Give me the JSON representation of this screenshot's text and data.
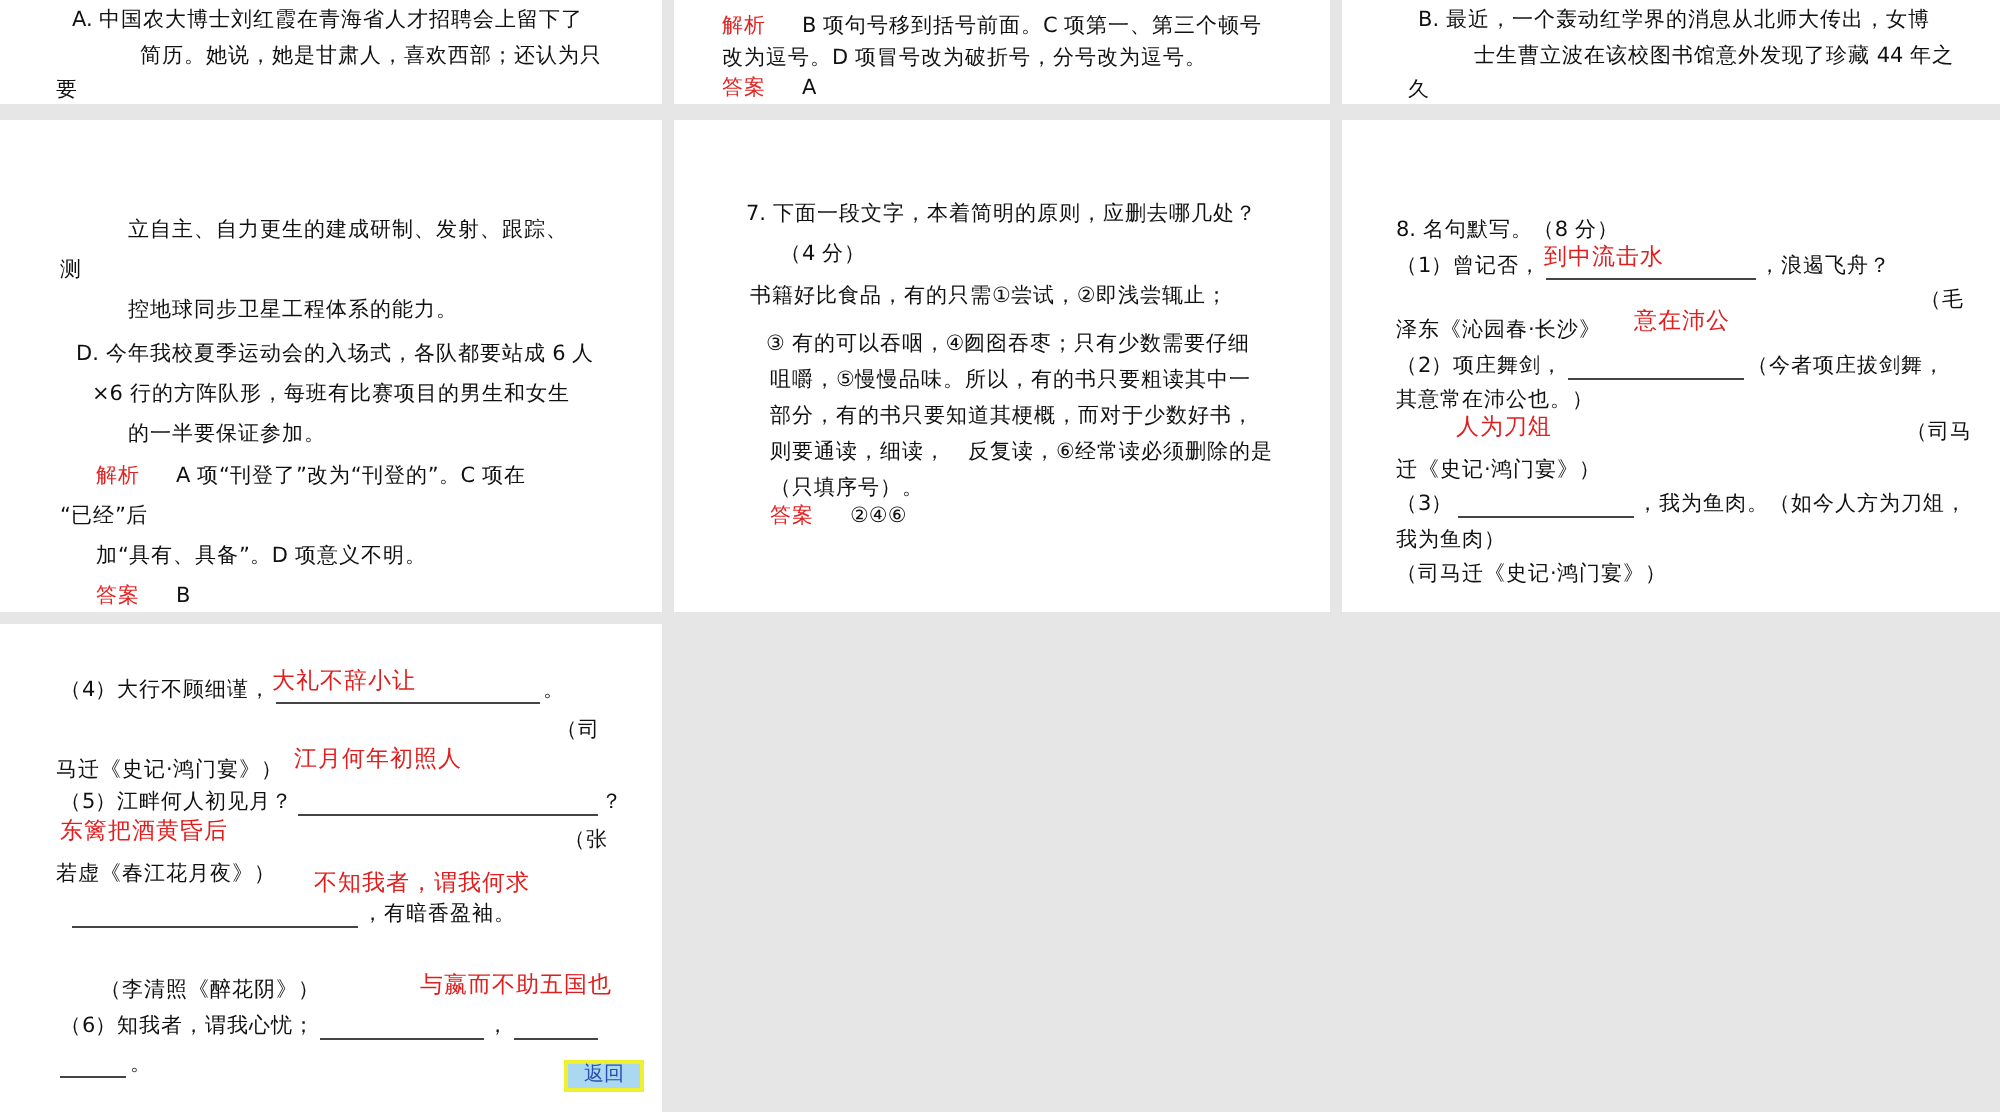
{
  "slides": [
    {
      "lines": [
        {
          "parts": [
            {
              "kind": "text",
              "text": "A. 中国农大博士刘红霞在青海省人才招聘会上留下了"
            }
          ]
        },
        {
          "parts": [
            {
              "kind": "text",
              "text": "简历。她说，她是甘肃人，喜欢西部；还认为只"
            }
          ]
        },
        {
          "parts": [
            {
              "kind": "text",
              "text": "要"
            }
          ]
        }
      ]
    },
    {
      "lines": [
        {
          "parts": [
            {
              "kind": "label",
              "text": "解析"
            },
            {
              "kind": "text",
              "text": "B 项句号移到括号前面。C 项第一、第三个顿号"
            }
          ]
        },
        {
          "parts": [
            {
              "kind": "text",
              "text": "改为逗号。D 项冒号改为破折号，分号改为逗号。"
            }
          ]
        },
        {
          "parts": [
            {
              "kind": "label",
              "text": "答案"
            },
            {
              "kind": "text",
              "text": "A"
            }
          ]
        }
      ]
    },
    {
      "lines": [
        {
          "parts": [
            {
              "kind": "text",
              "text": "B. 最近，一个轰动红学界的消息从北师大传出，女博"
            }
          ]
        },
        {
          "parts": [
            {
              "kind": "text",
              "text": "士生曹立波在该校图书馆意外发现了珍藏 44 年之"
            }
          ]
        },
        {
          "parts": [
            {
              "kind": "text",
              "text": "久"
            }
          ]
        }
      ]
    },
    {
      "lines": [
        {
          "parts": [
            {
              "kind": "text",
              "text": "立自主、自力更生的建成研制、发射、跟踪、"
            }
          ]
        },
        {
          "parts": [
            {
              "kind": "text",
              "text": "测"
            }
          ]
        },
        {
          "parts": [
            {
              "kind": "text",
              "text": "控地球同步卫星工程体系的能力。"
            }
          ]
        },
        {
          "parts": [
            {
              "kind": "text",
              "text": "D. 今年我校夏季运动会的入场式，各队都要站成 6 人"
            }
          ]
        },
        {
          "parts": [
            {
              "kind": "text",
              "text": "×6 行的方阵队形，每班有比赛项目的男生和女生"
            }
          ]
        },
        {
          "parts": [
            {
              "kind": "text",
              "text": "的一半要保证参加。"
            }
          ]
        },
        {
          "parts": [
            {
              "kind": "label",
              "text": "解析"
            },
            {
              "kind": "text",
              "text": "A 项“刊登了”改为“刊登的”。C 项在"
            }
          ]
        },
        {
          "parts": [
            {
              "kind": "text",
              "text": "“已经”后"
            }
          ]
        },
        {
          "parts": [
            {
              "kind": "text",
              "text": "加“具有、具备”。D 项意义不明。"
            }
          ]
        },
        {
          "parts": [
            {
              "kind": "label",
              "text": "答案"
            },
            {
              "kind": "text",
              "text": "B"
            }
          ]
        }
      ]
    },
    {
      "lines": [
        {
          "parts": [
            {
              "kind": "text",
              "text": "7. 下面一段文字，本着简明的原则，应删去哪几处？"
            }
          ]
        },
        {
          "parts": [
            {
              "kind": "text",
              "text": "（4 分）"
            }
          ]
        },
        {
          "parts": [
            {
              "kind": "text",
              "text": "书籍好比食品，有的只需①尝试，②即浅尝辄止；"
            }
          ]
        },
        {
          "parts": [
            {
              "kind": "text",
              "text": "③ 有的可以吞咽，④囫囵吞枣；只有少数需要仔细"
            }
          ]
        },
        {
          "parts": [
            {
              "kind": "text",
              "text": "咀嚼，⑤慢慢品味。所以，有的书只要粗读其中一"
            }
          ]
        },
        {
          "parts": [
            {
              "kind": "text",
              "text": "部分，有的书只要知道其梗概，而对于少数好书，"
            }
          ]
        },
        {
          "parts": [
            {
              "kind": "text",
              "text": "则要通读，细读，　反复读，⑥经常读必须删除的是"
            }
          ]
        },
        {
          "parts": [
            {
              "kind": "text",
              "text": "（只填序号）。"
            }
          ]
        },
        {
          "parts": [
            {
              "kind": "label",
              "text": "答案"
            },
            {
              "kind": "text",
              "text": "②④⑥"
            }
          ]
        }
      ]
    },
    {
      "lines": [
        {
          "parts": [
            {
              "kind": "text",
              "text": "8. 名句默写。（8 分）"
            }
          ]
        },
        {
          "parts": [
            {
              "kind": "text",
              "text": "（1）曾记否，"
            },
            {
              "kind": "blank"
            },
            {
              "kind": "text",
              "text": "，浪遏飞舟？"
            }
          ]
        },
        {
          "parts": [
            {
              "kind": "text",
              "text": "（毛"
            }
          ]
        },
        {
          "parts": [
            {
              "kind": "text",
              "text": "泽东《沁园春·长沙》"
            }
          ]
        },
        {
          "parts": [
            {
              "kind": "text",
              "text": "（2）项庄舞剑，"
            },
            {
              "kind": "blank"
            },
            {
              "kind": "text",
              "text": "（今者项庄拔剑舞，"
            }
          ]
        },
        {
          "parts": [
            {
              "kind": "text",
              "text": "其意常在沛公也。）"
            }
          ]
        },
        {
          "parts": [
            {
              "kind": "text",
              "text": "（司马"
            }
          ]
        },
        {
          "parts": [
            {
              "kind": "text",
              "text": "迁《史记·鸿门宴》）"
            }
          ]
        },
        {
          "parts": [
            {
              "kind": "text",
              "text": "（3）"
            },
            {
              "kind": "blank"
            },
            {
              "kind": "text",
              "text": "，我为鱼肉。（如今人方为刀俎，"
            }
          ]
        },
        {
          "parts": [
            {
              "kind": "text",
              "text": "我为鱼肉）"
            }
          ]
        },
        {
          "parts": [
            {
              "kind": "text",
              "text": "（司马迁《史记·鸿门宴》）"
            }
          ]
        }
      ],
      "answers": [
        {
          "text": "到中流击水"
        },
        {
          "text": "意在沛公"
        },
        {
          "text": "人为刀俎"
        }
      ]
    },
    {
      "lines": [
        {
          "parts": [
            {
              "kind": "text",
              "text": "（4）大行不顾细谨，"
            },
            {
              "kind": "blank"
            },
            {
              "kind": "text",
              "text": "。"
            }
          ]
        },
        {
          "parts": [
            {
              "kind": "text",
              "text": "（司"
            }
          ]
        },
        {
          "parts": [
            {
              "kind": "text",
              "text": "马迁《史记·鸿门宴》）"
            }
          ]
        },
        {
          "parts": [
            {
              "kind": "text",
              "text": "（5）江畔何人初见月？"
            },
            {
              "kind": "blank"
            },
            {
              "kind": "text",
              "text": "？"
            }
          ]
        },
        {
          "parts": [
            {
              "kind": "text",
              "text": "（张"
            }
          ]
        },
        {
          "parts": [
            {
              "kind": "text",
              "text": "若虚《春江花月夜》）"
            }
          ]
        },
        {
          "parts": [
            {
              "kind": "blank"
            },
            {
              "kind": "text",
              "text": "，有暗香盈袖。"
            }
          ]
        },
        {
          "parts": [
            {
              "kind": "text",
              "text": "（李清照《醉花阴》）"
            }
          ]
        },
        {
          "parts": [
            {
              "kind": "text",
              "text": "（6）知我者，谓我心忧；"
            },
            {
              "kind": "blank"
            },
            {
              "kind": "text",
              "text": "，"
            },
            {
              "kind": "blank"
            }
          ]
        },
        {
          "parts": [
            {
              "kind": "blank"
            },
            {
              "kind": "text",
              "text": "。"
            }
          ]
        }
      ],
      "answers": [
        {
          "text": "大礼不辞小让"
        },
        {
          "text": "江月何年初照人"
        },
        {
          "text": "东篱把酒黄昏后"
        },
        {
          "text": "不知我者，谓我何求"
        },
        {
          "text": "与嬴而不助五国也"
        }
      ],
      "button": {
        "label": "返回"
      }
    }
  ]
}
